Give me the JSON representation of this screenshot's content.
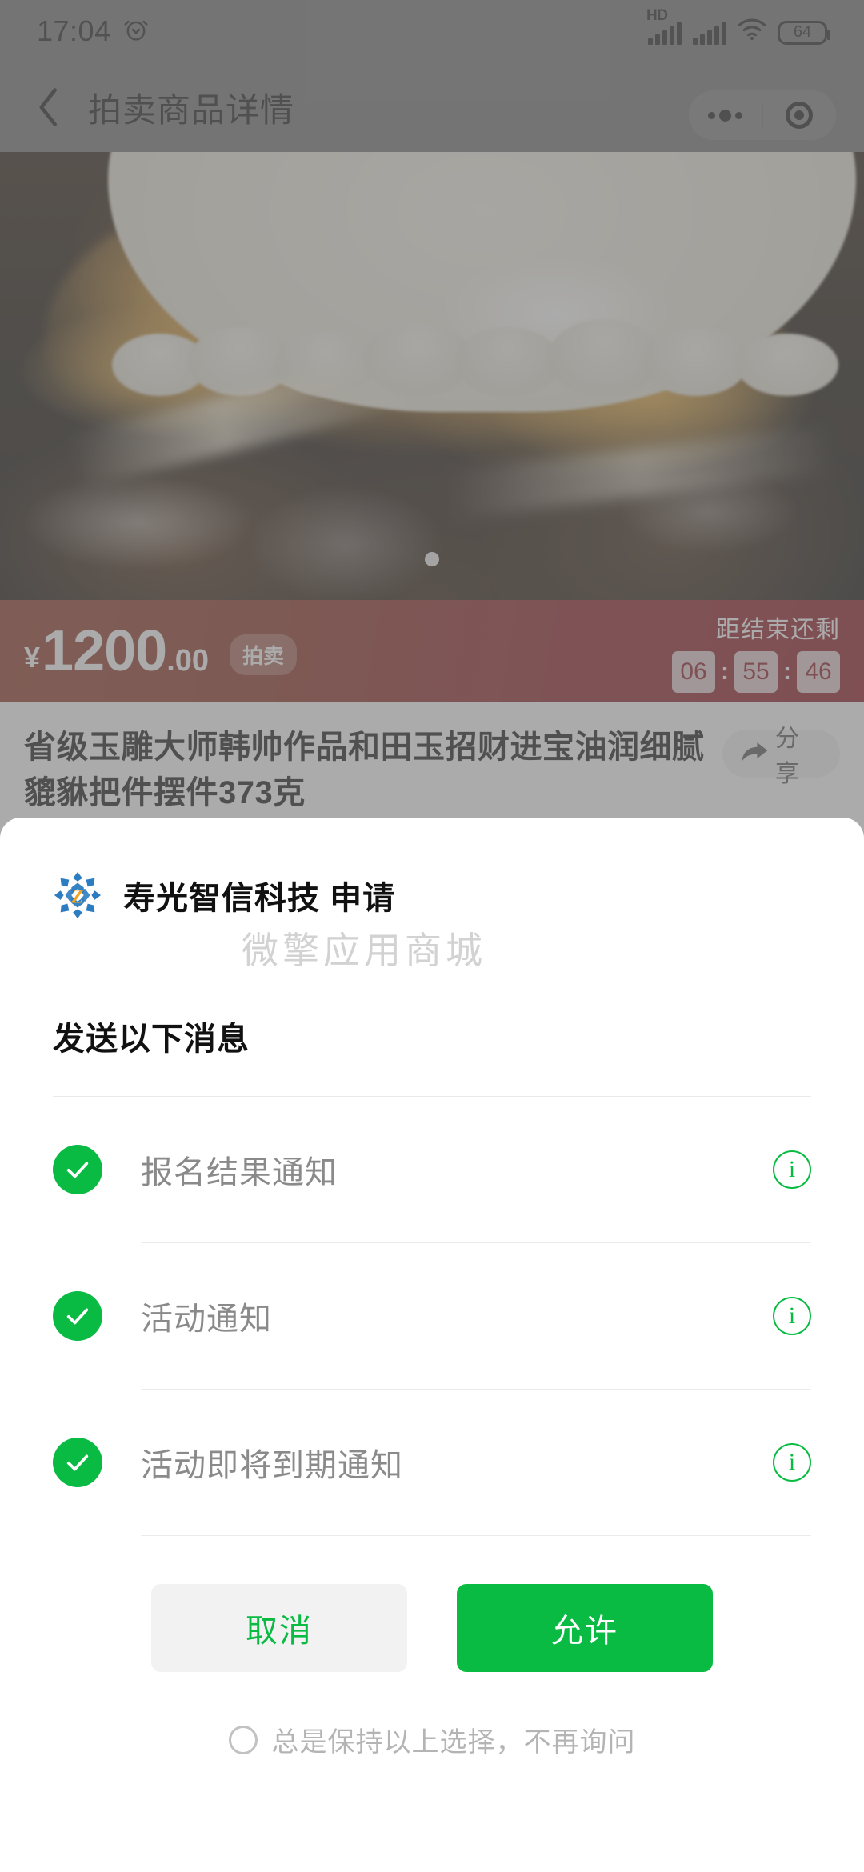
{
  "status_bar": {
    "time": "17:04",
    "alarm_icon": "alarm-clock-icon",
    "hd_label": "HD",
    "signal_icon": "signal-bars-icon",
    "signal2_icon": "signal-bars-icon",
    "wifi_icon": "wifi-icon",
    "battery_level": "64"
  },
  "nav": {
    "back_icon": "chevron-left-icon",
    "title": "拍卖商品详情",
    "menu_icon": "more-dots-icon",
    "capsule_icon": "target-circle-icon"
  },
  "hero": {
    "carousel_dot": "carousel-dot-indicator"
  },
  "price_bar": {
    "currency": "¥",
    "amount_int": "1200",
    "amount_dec": ".00",
    "badge": "拍卖",
    "countdown_label": "距结束还剩",
    "hours": "06",
    "minutes": "55",
    "seconds": "46",
    "separator": ":"
  },
  "product": {
    "title": "省级玉雕大师韩帅作品和田玉招财进宝油润细腻貔貅把件摆件373克",
    "share_label": "分享",
    "share_icon": "share-arrow-icon"
  },
  "modal": {
    "logo_icon": "shouguang-zhixin-logo",
    "app_request": "寿光智信科技  申请",
    "watermark": "微擎应用商城",
    "section_title": "发送以下消息",
    "messages": [
      {
        "label": "报名结果通知",
        "checked": true,
        "info_icon": "info-circle-icon"
      },
      {
        "label": "活动通知",
        "checked": true,
        "info_icon": "info-circle-icon"
      },
      {
        "label": "活动即将到期通知",
        "checked": true,
        "info_icon": "info-circle-icon"
      }
    ],
    "cancel_label": "取消",
    "allow_label": "允许",
    "always_label": "总是保持以上选择，不再询问",
    "always_checked": false
  },
  "colors": {
    "wechat_green": "#09bb43",
    "price_bar_left": "#8c3320",
    "price_bar_right": "#8d0f18",
    "muted_text": "#8a8a8a",
    "watermark_grey": "#d2d2d2"
  }
}
